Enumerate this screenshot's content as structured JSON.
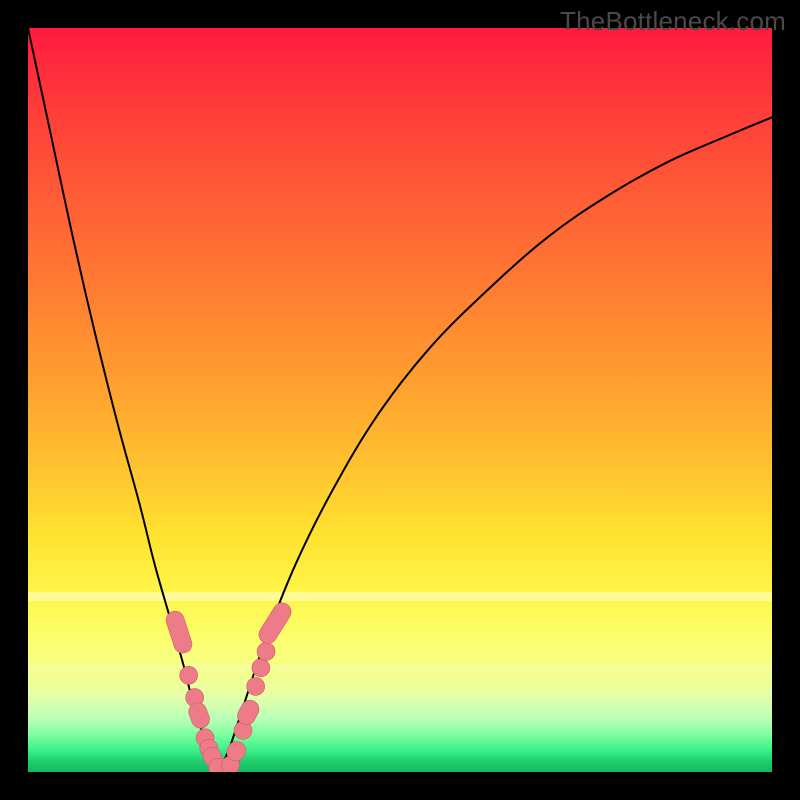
{
  "watermark": "TheBottleneck.com",
  "colors": {
    "frame": "#000000",
    "curve": "#000000",
    "marker_fill": "#ee7b88",
    "marker_stroke": "#d25a6a"
  },
  "chart_data": {
    "type": "line",
    "title": "",
    "xlabel": "",
    "ylabel": "",
    "xlim": [
      0,
      100
    ],
    "ylim": [
      0,
      100
    ],
    "grid": false,
    "legend": false,
    "series": [
      {
        "name": "left-branch",
        "x": [
          0,
          3,
          6,
          9,
          12,
          15,
          17,
          19,
          21,
          22.5,
          24,
          25,
          25.8
        ],
        "y": [
          100,
          86,
          72,
          59,
          47,
          36,
          28,
          21,
          14,
          8,
          4,
          1.5,
          0.6
        ]
      },
      {
        "name": "right-branch",
        "x": [
          25.8,
          27,
          29,
          32,
          36,
          41,
          47,
          54,
          62,
          70,
          78,
          86,
          94,
          100
        ],
        "y": [
          0.6,
          3,
          9,
          18,
          28,
          38,
          48,
          57,
          65,
          72,
          77.5,
          82,
          85.5,
          88
        ]
      }
    ],
    "markers": [
      {
        "branch": "left",
        "x": 20.3,
        "y": 18.8,
        "shape": "pill",
        "len": 5.8,
        "angle": -72
      },
      {
        "branch": "left",
        "x": 21.6,
        "y": 13.0,
        "shape": "round"
      },
      {
        "branch": "left",
        "x": 22.4,
        "y": 10.0,
        "shape": "round"
      },
      {
        "branch": "left",
        "x": 23.0,
        "y": 7.6,
        "shape": "pill",
        "len": 3.5,
        "angle": -70
      },
      {
        "branch": "left",
        "x": 23.8,
        "y": 4.6,
        "shape": "round"
      },
      {
        "branch": "left",
        "x": 24.3,
        "y": 3.2,
        "shape": "round"
      },
      {
        "branch": "left",
        "x": 24.8,
        "y": 2.0,
        "shape": "pill",
        "len": 2.6,
        "angle": -60
      },
      {
        "branch": "floor",
        "x": 25.8,
        "y": 0.6,
        "shape": "pill",
        "len": 3.0,
        "angle": 0
      },
      {
        "branch": "floor",
        "x": 27.2,
        "y": 0.9,
        "shape": "round"
      },
      {
        "branch": "right",
        "x": 28.0,
        "y": 2.8,
        "shape": "pill",
        "len": 2.6,
        "angle": 60
      },
      {
        "branch": "right",
        "x": 28.9,
        "y": 5.6,
        "shape": "round"
      },
      {
        "branch": "right",
        "x": 29.6,
        "y": 8.0,
        "shape": "pill",
        "len": 3.4,
        "angle": 62
      },
      {
        "branch": "right",
        "x": 30.6,
        "y": 11.5,
        "shape": "round"
      },
      {
        "branch": "right",
        "x": 31.3,
        "y": 14.0,
        "shape": "round"
      },
      {
        "branch": "right",
        "x": 32.0,
        "y": 16.2,
        "shape": "round"
      },
      {
        "branch": "right",
        "x": 33.2,
        "y": 20.0,
        "shape": "pill",
        "len": 6.0,
        "angle": 58
      }
    ]
  }
}
